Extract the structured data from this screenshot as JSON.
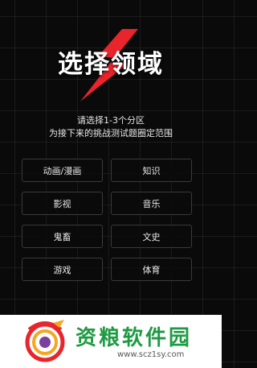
{
  "header": {
    "title": "选择领域",
    "subtitle_line1": "请选择1-3个分区",
    "subtitle_line2": "为接下来的挑战测试题圈定范围"
  },
  "categories": [
    {
      "label": "动画/漫画"
    },
    {
      "label": "知识"
    },
    {
      "label": "影视"
    },
    {
      "label": "音乐"
    },
    {
      "label": "鬼畜"
    },
    {
      "label": "文史"
    },
    {
      "label": "游戏"
    },
    {
      "label": "体育"
    }
  ],
  "watermark": {
    "brand": "资粮软件园",
    "url": "www.scz1sy.com"
  },
  "colors": {
    "accent_red": "#e8242c",
    "background": "#0a0a0a",
    "brand_green": "#1f9a44"
  }
}
